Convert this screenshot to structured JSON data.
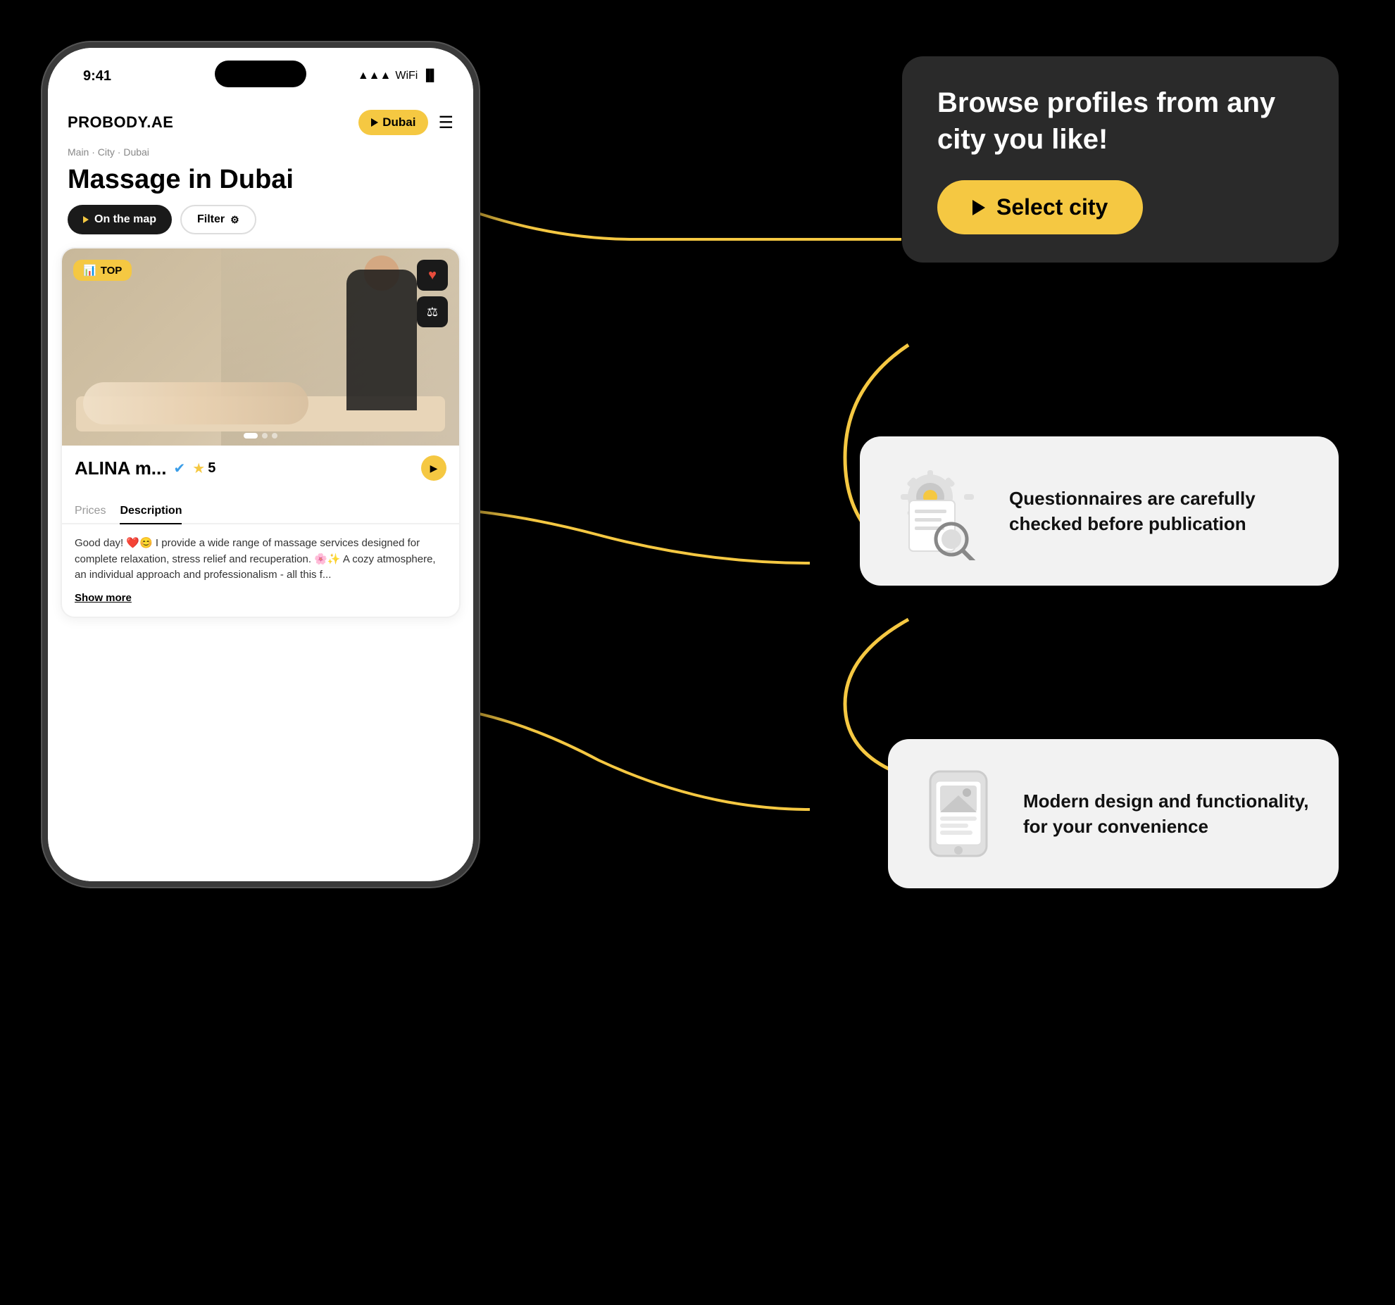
{
  "app": {
    "logo": "PROBODY.AE",
    "city_button": "Dubai",
    "hamburger_icon": "☰"
  },
  "status_bar": {
    "time": "9:41",
    "signal": "▲▲▲",
    "wifi": "WiFi",
    "battery": "🔋"
  },
  "breadcrumb": "Main  ·  City  ·  Dubai",
  "page_title": "Massage in Dubai",
  "buttons": {
    "on_the_map": "On the map",
    "filter": "Filter"
  },
  "profile": {
    "name": "ALINA m...",
    "verified": true,
    "rating": "5",
    "top_badge": "TOP",
    "tabs": [
      "Prices",
      "Description"
    ],
    "active_tab": "Description",
    "description": "Good day! ❤️😊 I provide a wide range of massage services designed for complete relaxation, stress relief and recuperation. 🌸✨ A cozy atmosphere, an individual approach and professionalism - all this f...",
    "show_more": "Show more"
  },
  "callouts": {
    "city": {
      "text": "Browse profiles from any city you like!",
      "button_label": "Select city"
    },
    "questionnaire": {
      "text": "Questionnaires are carefully checked before publication"
    },
    "design": {
      "text": "Modern design and functionality, for your convenience"
    }
  },
  "icons": {
    "map_arrow": "▶",
    "heart": "♥",
    "compare": "⚖",
    "verified": "✔",
    "star": "★",
    "nav_arrow": "▶",
    "top_bar_icon": "📊",
    "gear": "⚙",
    "mobile": "📱"
  }
}
